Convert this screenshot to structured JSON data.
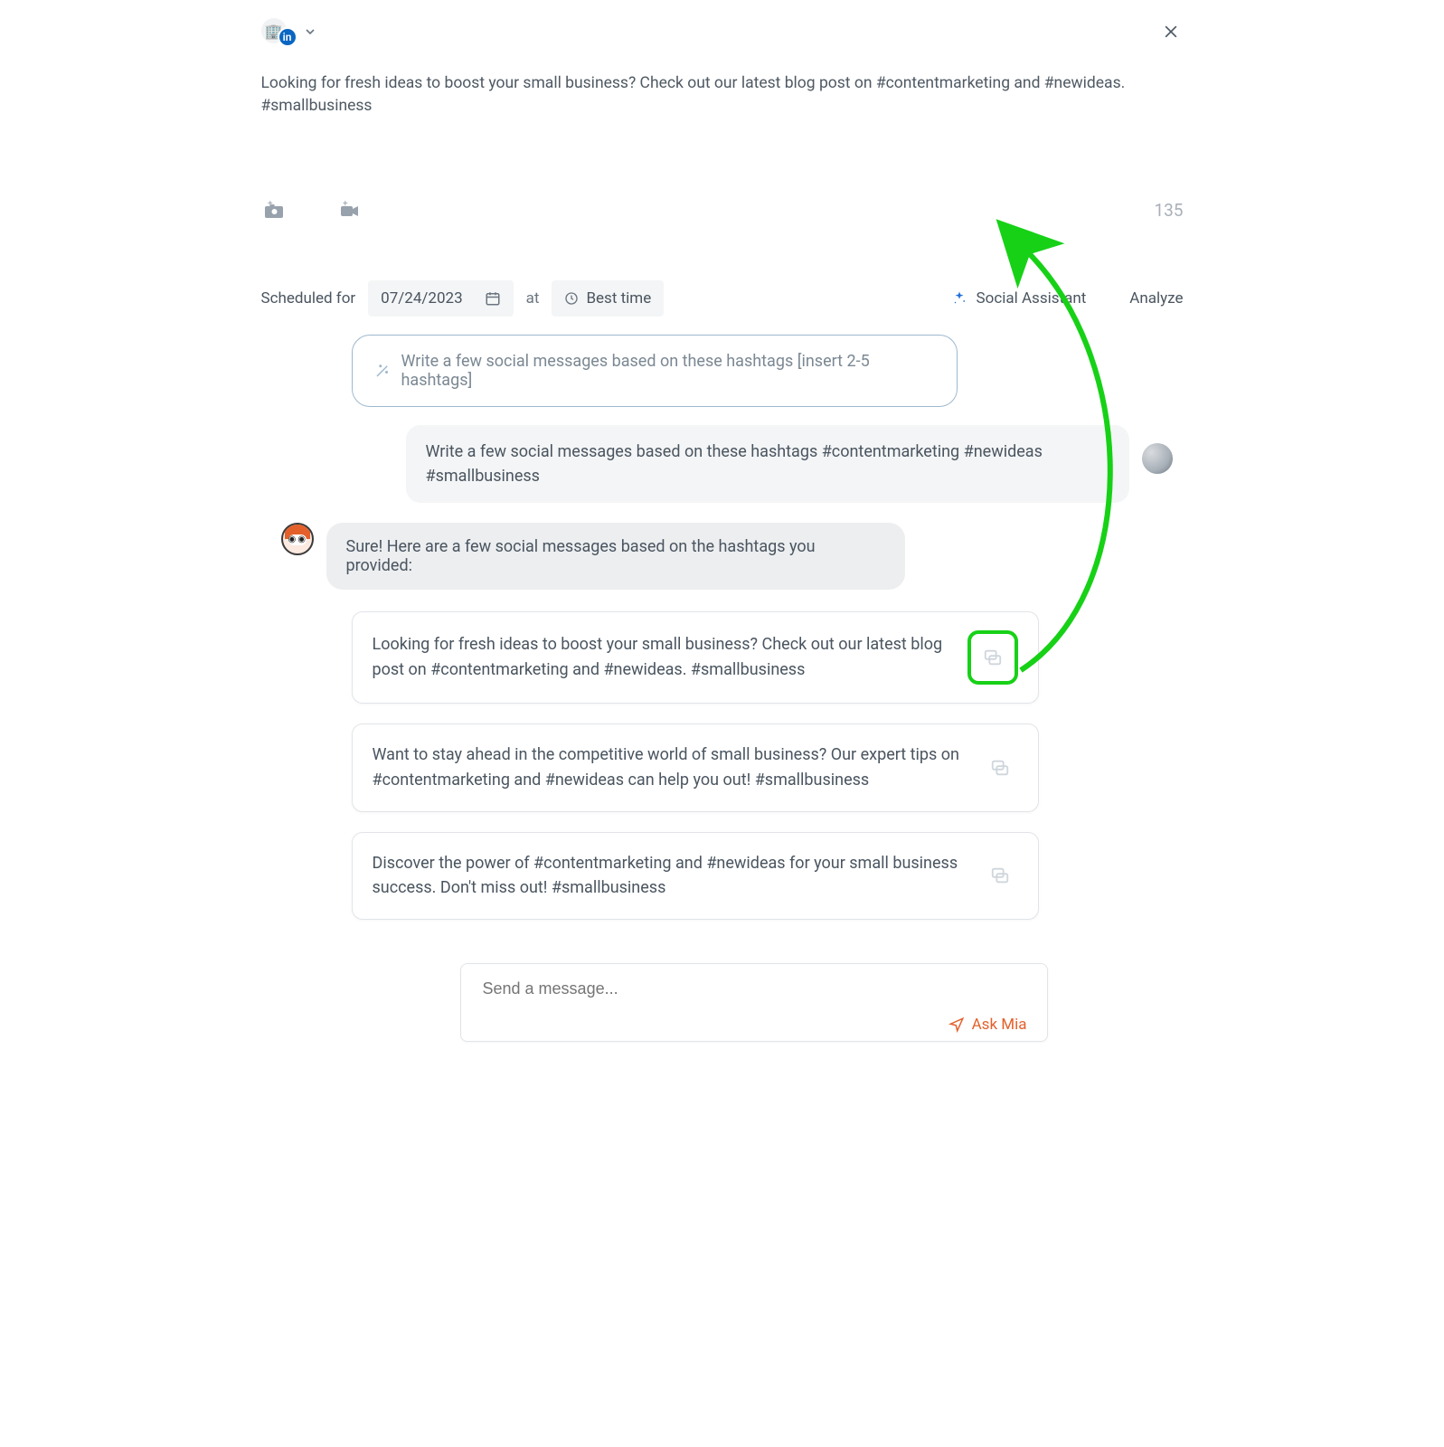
{
  "account": {
    "building_glyph": "🏢",
    "network_badge": "in"
  },
  "composer": {
    "text": "Looking for fresh ideas to boost your small business? Check out our latest blog post on #contentmarketing and #newideas. #smallbusiness",
    "char_count": "135"
  },
  "schedule": {
    "label": "Scheduled for",
    "date": "07/24/2023",
    "at_label": "at",
    "best_time": "Best time"
  },
  "links": {
    "social_assistant": "Social Assistant",
    "analyze": "Analyze"
  },
  "chat": {
    "suggestion_prompt": "Write a few social messages based on these hashtags [insert 2-5 hashtags]",
    "user_message": "Write a few social messages based on these hashtags #contentmarketing #newideas #smallbusiness",
    "assistant_message": "Sure! Here are a few social messages based on the hashtags you provided:",
    "suggestions": [
      "Looking for fresh ideas to boost your small business? Check out our latest blog post on #contentmarketing and #newideas. #smallbusiness",
      "Want to stay ahead in the competitive world of small business? Our expert tips on #contentmarketing and #newideas can help you out! #smallbusiness",
      "Discover the power of #contentmarketing and #newideas for your small business success. Don't miss out! #smallbusiness"
    ]
  },
  "send": {
    "placeholder": "Send a message...",
    "ask_mia": "Ask Mia"
  },
  "colors": {
    "accent_green": "#17d117",
    "accent_orange": "#e3602b",
    "accent_blue": "#1f6fd6"
  }
}
